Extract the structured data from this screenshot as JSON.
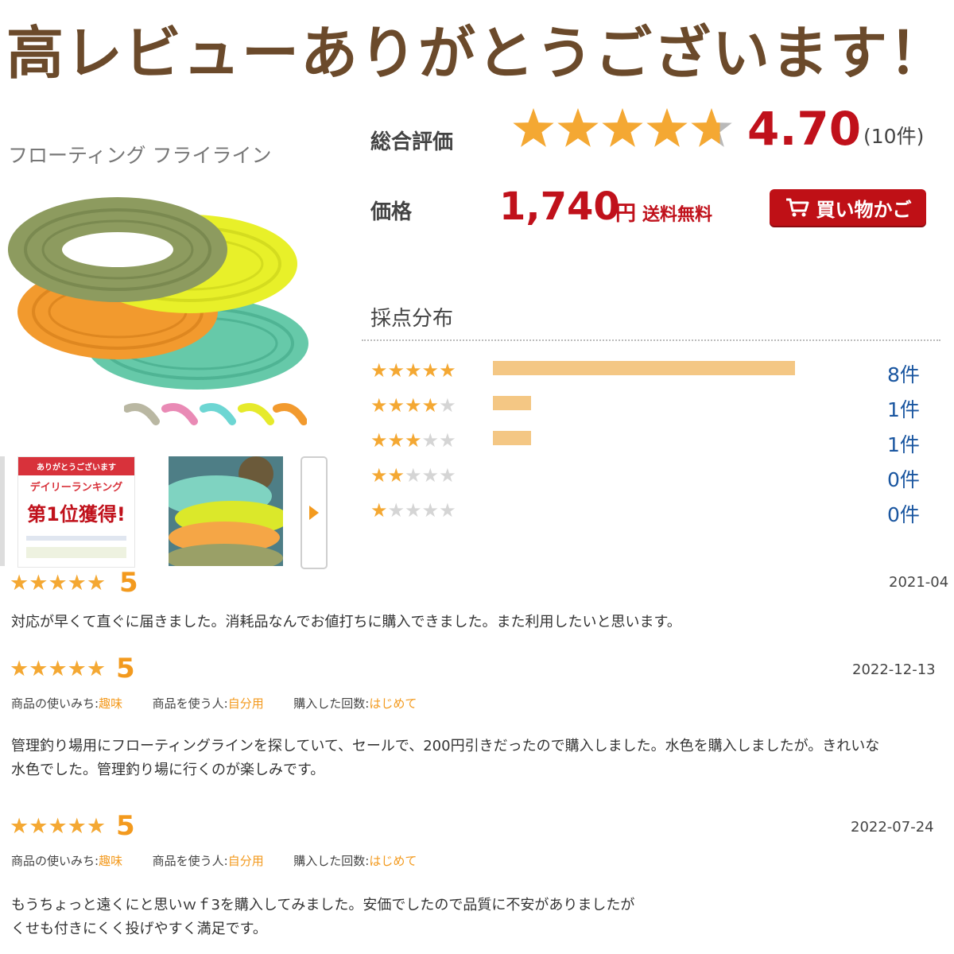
{
  "headline": "高レビューありがとうございます！",
  "product": {
    "title": "フローティング フライライン",
    "swatch_colors": [
      "#b9b7a2",
      "#e98ab5",
      "#6dd6d3",
      "#e6ea2b",
      "#f29a2e"
    ],
    "thumbnail_text": {
      "line1": "ありがとうございます",
      "line2": "デイリーランキング",
      "line3": "第1位獲得!"
    }
  },
  "overall": {
    "label": "総合評価",
    "stars": 4.7,
    "score": "4.70",
    "count": "(10件)"
  },
  "price": {
    "label": "価格",
    "value": "1,740",
    "unit": "円",
    "shipping": "送料無料",
    "cart_button": "買い物かご"
  },
  "distribution": {
    "title": "採点分布",
    "rows": [
      {
        "stars": 5,
        "share": 1.0,
        "count": "8件"
      },
      {
        "stars": 4,
        "share": 0.125,
        "count": "1件"
      },
      {
        "stars": 3,
        "share": 0.125,
        "count": "1件"
      },
      {
        "stars": 2,
        "share": 0,
        "count": "0件"
      },
      {
        "stars": 1,
        "share": 0,
        "count": "0件"
      }
    ]
  },
  "reviews": [
    {
      "stars": 5,
      "score": "5",
      "date": "2021-04",
      "body": "対応が早くて直ぐに届きました。消耗品なんでお値打ちに購入できました。また利用したいと思います。"
    },
    {
      "stars": 5,
      "score": "5",
      "date": "2022-12-13",
      "meta": [
        {
          "k": "商品の使いみち:",
          "v": "趣味"
        },
        {
          "k": "商品を使う人:",
          "v": "自分用"
        },
        {
          "k": "購入した回数:",
          "v": "はじめて"
        }
      ],
      "body1": "管理釣り場用にフローティングラインを探していて、セールで、200円引きだったので購入しました。水色を購入しましたが。きれいな",
      "body2": "水色でした。管理釣り場に行くのが楽しみです。"
    },
    {
      "stars": 5,
      "score": "5",
      "date": "2022-07-24",
      "meta": [
        {
          "k": "商品の使いみち:",
          "v": "趣味"
        },
        {
          "k": "商品を使う人:",
          "v": "自分用"
        },
        {
          "k": "購入した回数:",
          "v": "はじめて"
        }
      ],
      "body1": "もうちょっと遠くにと思いｗｆ3を購入してみました。安価でしたので品質に不安がありましたが",
      "body2": "くせも付きにくく投げやすく満足です。"
    }
  ]
}
